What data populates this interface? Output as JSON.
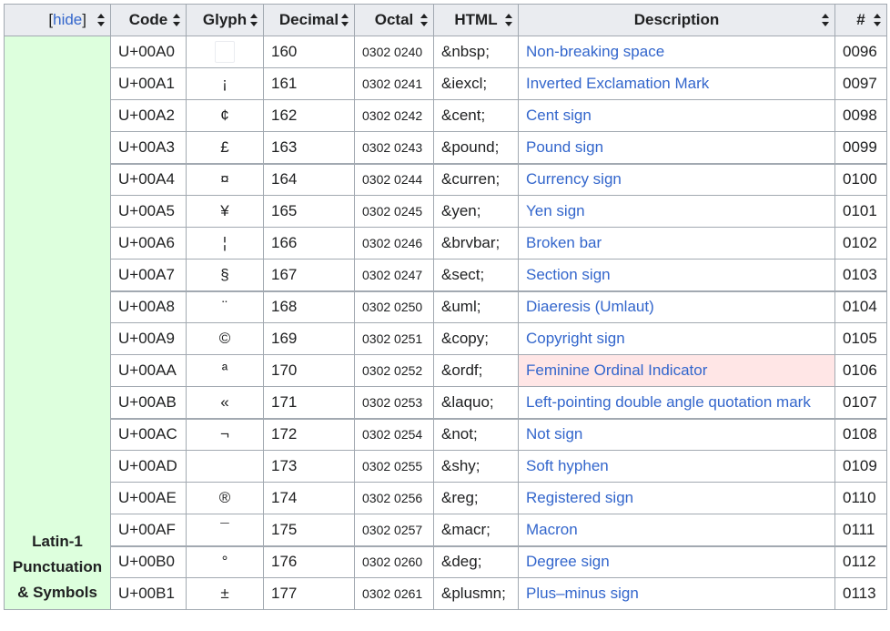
{
  "header": {
    "hide_open": "[",
    "hide_link": "hide",
    "hide_close": "]",
    "code": "Code",
    "glyph": "Glyph",
    "decimal": "Decimal",
    "octal": "Octal",
    "html": "HTML",
    "description": "Description",
    "number": "#"
  },
  "group": {
    "line1": "Latin-1",
    "line2": "Punctuation",
    "line3": "& Symbols",
    "color": "#ddffdd"
  },
  "rows": [
    {
      "code": "U+00A0",
      "glyph": "",
      "decimal": "160",
      "octal": "0302 0240",
      "html": "&nbsp;",
      "desc": "Non-breaking space",
      "num": "0096"
    },
    {
      "code": "U+00A1",
      "glyph": "¡",
      "decimal": "161",
      "octal": "0302 0241",
      "html": "&iexcl;",
      "desc": "Inverted Exclamation Mark",
      "num": "0097"
    },
    {
      "code": "U+00A2",
      "glyph": "¢",
      "decimal": "162",
      "octal": "0302 0242",
      "html": "&cent;",
      "desc": "Cent sign",
      "num": "0098"
    },
    {
      "code": "U+00A3",
      "glyph": "£",
      "decimal": "163",
      "octal": "0302 0243",
      "html": "&pound;",
      "desc": "Pound sign",
      "num": "0099"
    },
    {
      "code": "U+00A4",
      "glyph": "¤",
      "decimal": "164",
      "octal": "0302 0244",
      "html": "&curren;",
      "desc": "Currency sign",
      "num": "0100"
    },
    {
      "code": "U+00A5",
      "glyph": "¥",
      "decimal": "165",
      "octal": "0302 0245",
      "html": "&yen;",
      "desc": "Yen sign",
      "num": "0101"
    },
    {
      "code": "U+00A6",
      "glyph": "¦",
      "decimal": "166",
      "octal": "0302 0246",
      "html": "&brvbar;",
      "desc": "Broken bar",
      "num": "0102"
    },
    {
      "code": "U+00A7",
      "glyph": "§",
      "decimal": "167",
      "octal": "0302 0247",
      "html": "&sect;",
      "desc": "Section sign",
      "num": "0103"
    },
    {
      "code": "U+00A8",
      "glyph": "¨",
      "decimal": "168",
      "octal": "0302 0250",
      "html": "&uml;",
      "desc": "Diaeresis (Umlaut)",
      "num": "0104"
    },
    {
      "code": "U+00A9",
      "glyph": "©",
      "decimal": "169",
      "octal": "0302 0251",
      "html": "&copy;",
      "desc": "Copyright sign",
      "num": "0105"
    },
    {
      "code": "U+00AA",
      "glyph": "ª",
      "decimal": "170",
      "octal": "0302 0252",
      "html": "&ordf;",
      "desc": "Feminine Ordinal Indicator",
      "num": "0106"
    },
    {
      "code": "U+00AB",
      "glyph": "«",
      "decimal": "171",
      "octal": "0302 0253",
      "html": "&laquo;",
      "desc": "Left-pointing double angle quotation mark",
      "num": "0107"
    },
    {
      "code": "U+00AC",
      "glyph": "¬",
      "decimal": "172",
      "octal": "0302 0254",
      "html": "&not;",
      "desc": "Not sign",
      "num": "0108"
    },
    {
      "code": "U+00AD",
      "glyph": "",
      "decimal": "173",
      "octal": "0302 0255",
      "html": "&shy;",
      "desc": "Soft hyphen",
      "num": "0109"
    },
    {
      "code": "U+00AE",
      "glyph": "®",
      "decimal": "174",
      "octal": "0302 0256",
      "html": "&reg;",
      "desc": "Registered sign",
      "num": "0110"
    },
    {
      "code": "U+00AF",
      "glyph": "¯",
      "decimal": "175",
      "octal": "0302 0257",
      "html": "&macr;",
      "desc": "Macron",
      "num": "0111"
    },
    {
      "code": "U+00B0",
      "glyph": "°",
      "decimal": "176",
      "octal": "0302 0260",
      "html": "&deg;",
      "desc": "Degree sign",
      "num": "0112"
    },
    {
      "code": "U+00B1",
      "glyph": "±",
      "decimal": "177",
      "octal": "0302 0261",
      "html": "&plusmn;",
      "desc": "Plus–minus sign",
      "num": "0113"
    }
  ],
  "highlight_row": 10,
  "highlight_color": "#ffe6e6",
  "link_color": "#3366cc"
}
